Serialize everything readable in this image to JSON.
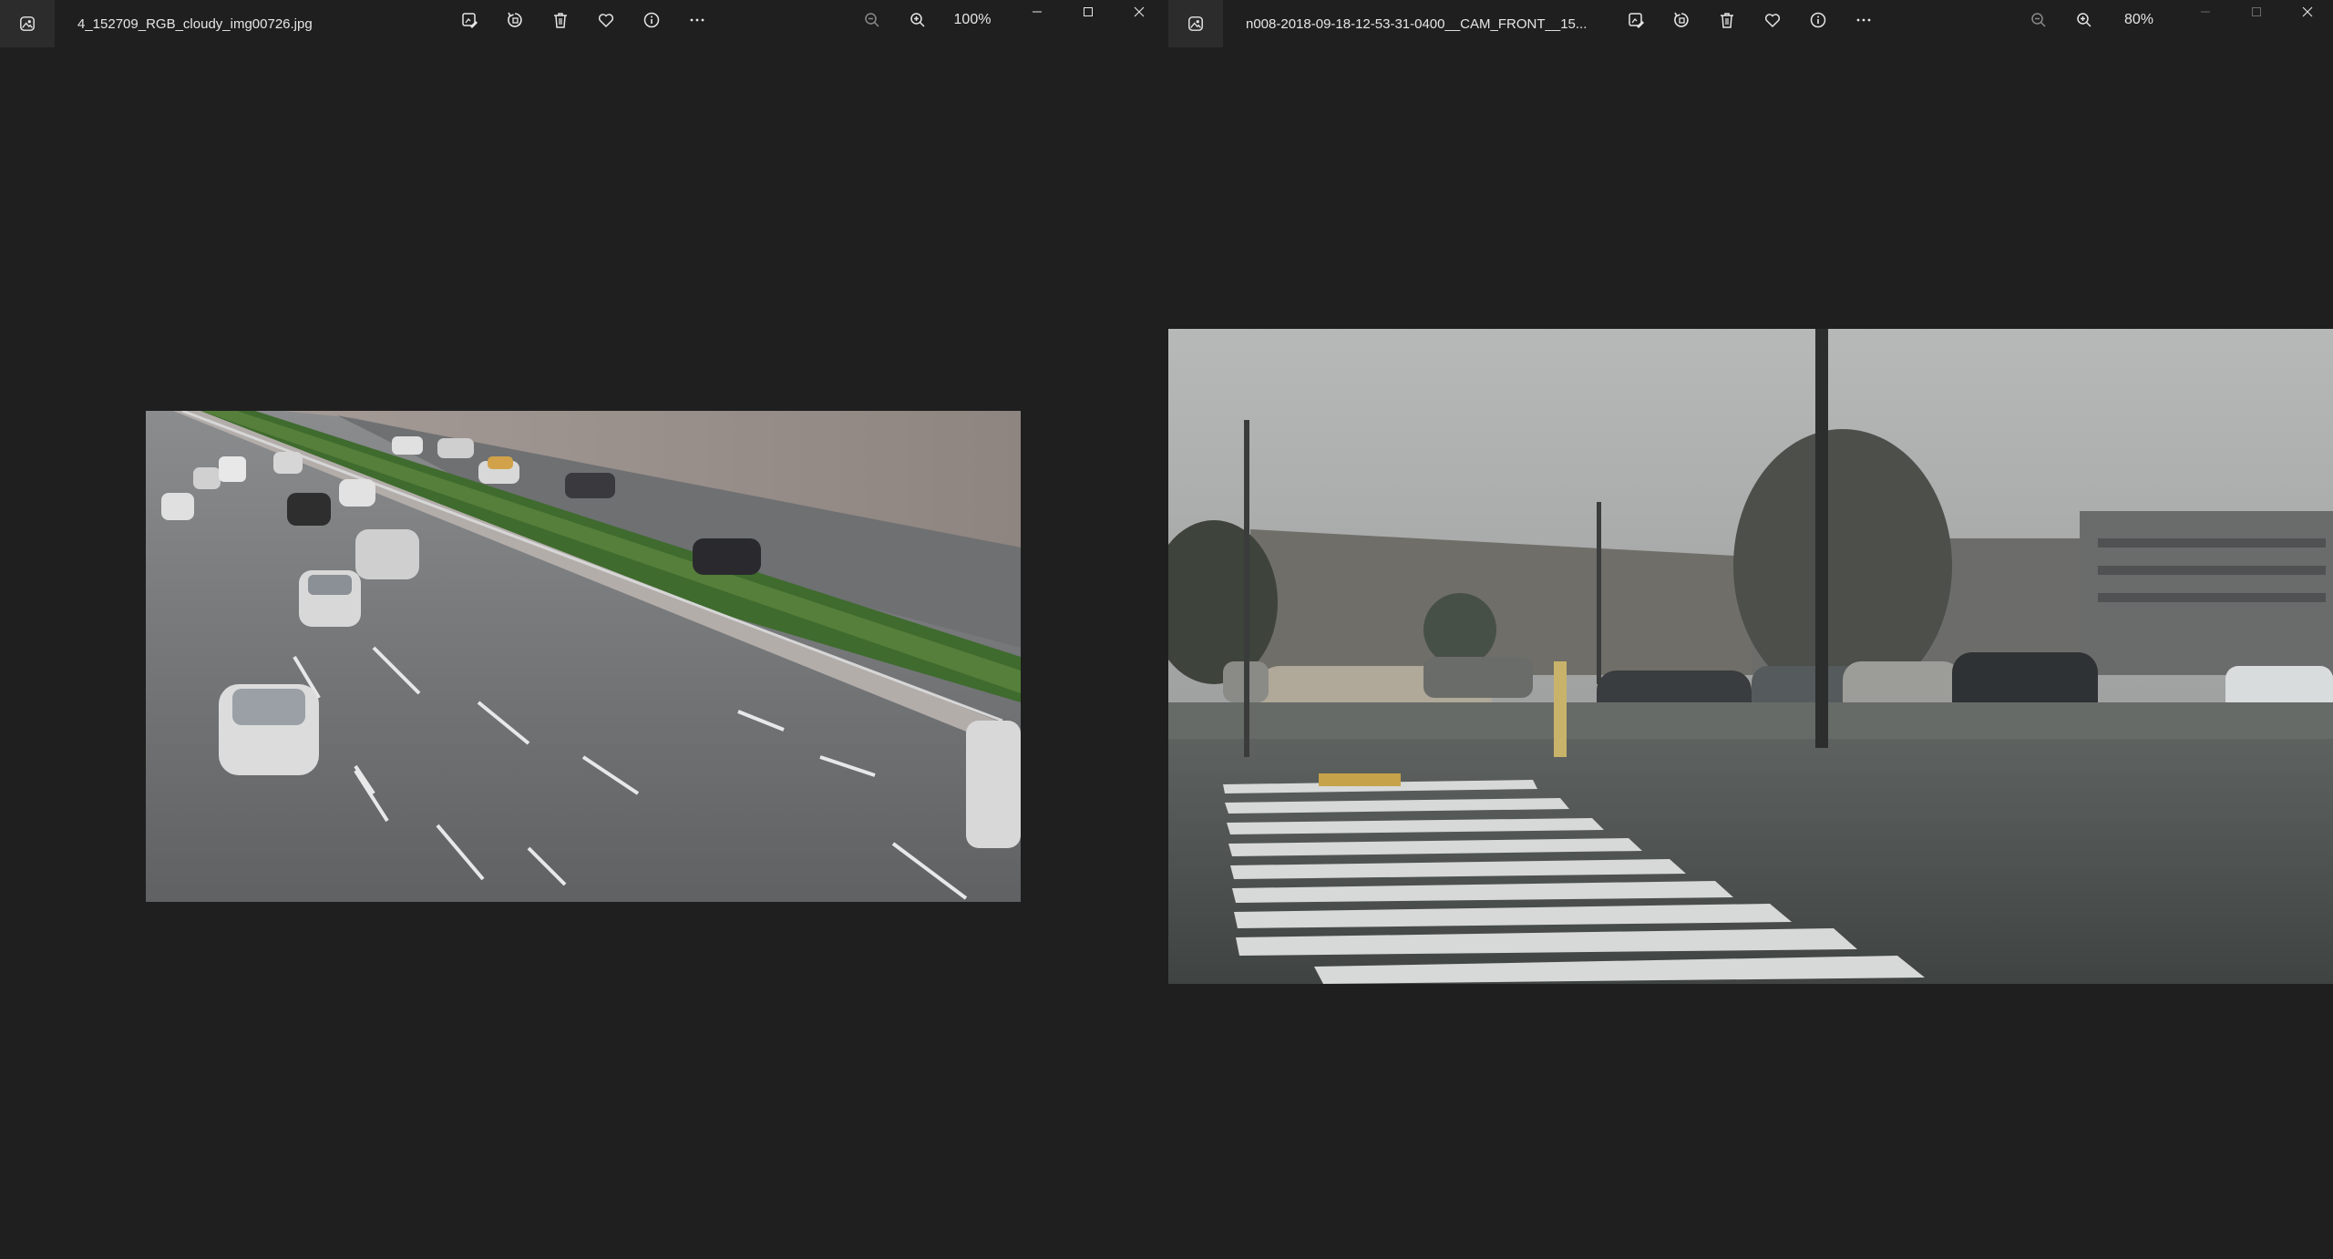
{
  "windows": [
    {
      "title": "4_152709_RGB_cloudy_img00726.jpg",
      "zoom": "100%",
      "toolbar_icons": [
        "edit-image-icon",
        "rotate-icon",
        "delete-icon",
        "favorite-icon",
        "info-icon",
        "more-icon"
      ],
      "zoom_icons": [
        "zoom-out-icon",
        "zoom-in-icon"
      ],
      "caption_icons": [
        "minimize-icon",
        "maximize-icon",
        "close-icon"
      ],
      "image_description_tag": "highway-traffic-photo"
    },
    {
      "title": "n008-2018-09-18-12-53-31-0400__CAM_FRONT__15...",
      "zoom": "80%",
      "toolbar_icons": [
        "edit-image-icon",
        "rotate-icon",
        "delete-icon",
        "favorite-icon",
        "info-icon",
        "more-icon"
      ],
      "zoom_icons": [
        "zoom-out-icon",
        "zoom-in-icon"
      ],
      "caption_icons": [
        "minimize-icon",
        "maximize-icon",
        "close-icon"
      ],
      "image_description_tag": "parking-lot-crosswalk-photo"
    }
  ],
  "colors": {
    "background": "#1f1f1f",
    "titlebar_icon_box": "#2c2c2c",
    "text": "#e6e6e6"
  }
}
